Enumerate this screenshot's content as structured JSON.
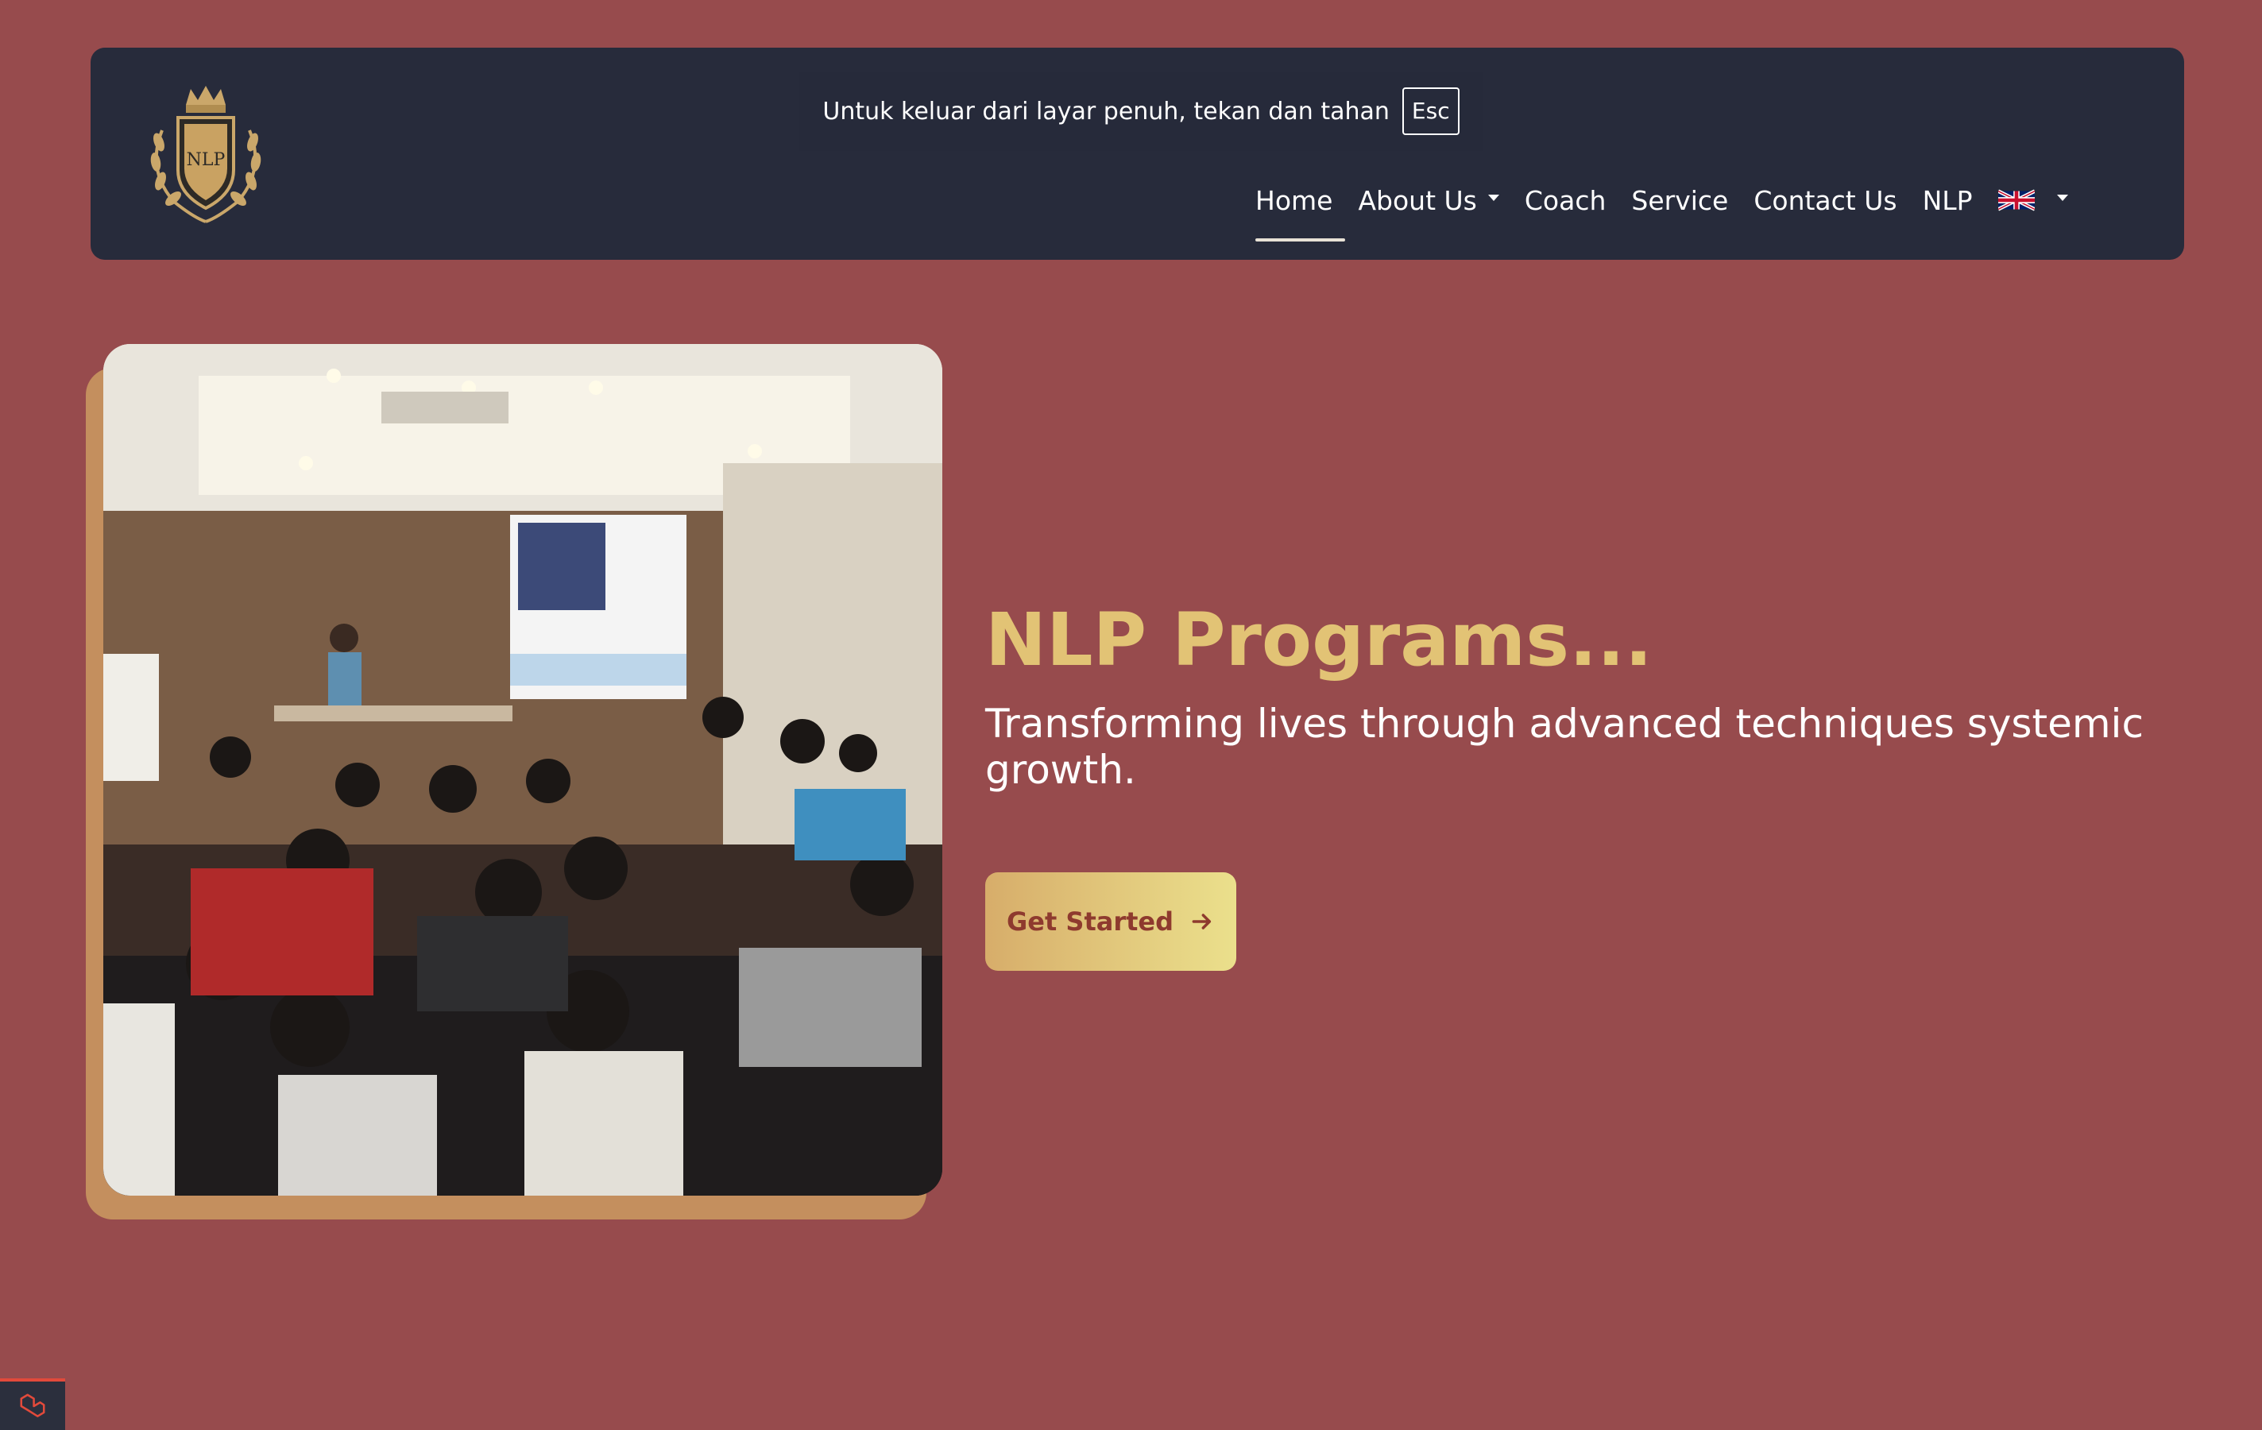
{
  "colors": {
    "background": "#974b4d",
    "navbar": "#272b3b",
    "accent_gold": "#e2c375",
    "button_text": "#8e3a2e"
  },
  "navbar": {
    "logo_text": "NLP",
    "items": [
      {
        "label": "Home",
        "active": true
      },
      {
        "label": "About Us",
        "has_dropdown": true
      },
      {
        "label": "Coach"
      },
      {
        "label": "Service"
      },
      {
        "label": "Contact Us"
      },
      {
        "label": "NLP"
      }
    ],
    "language": {
      "icon": "uk-flag-icon",
      "has_dropdown": true
    }
  },
  "fullscreen_notice": {
    "text": "Untuk keluar dari layar penuh, tekan dan tahan",
    "key": "Esc"
  },
  "hero": {
    "image_alt": "Seminar room with audience facing a presenter",
    "title": "NLP Programs...",
    "subtitle": "Transforming lives through advanced techniques systemic growth.",
    "cta_label": "Get Started",
    "cta_icon": "arrow-right-icon"
  },
  "corner_icon": "laravel-icon"
}
